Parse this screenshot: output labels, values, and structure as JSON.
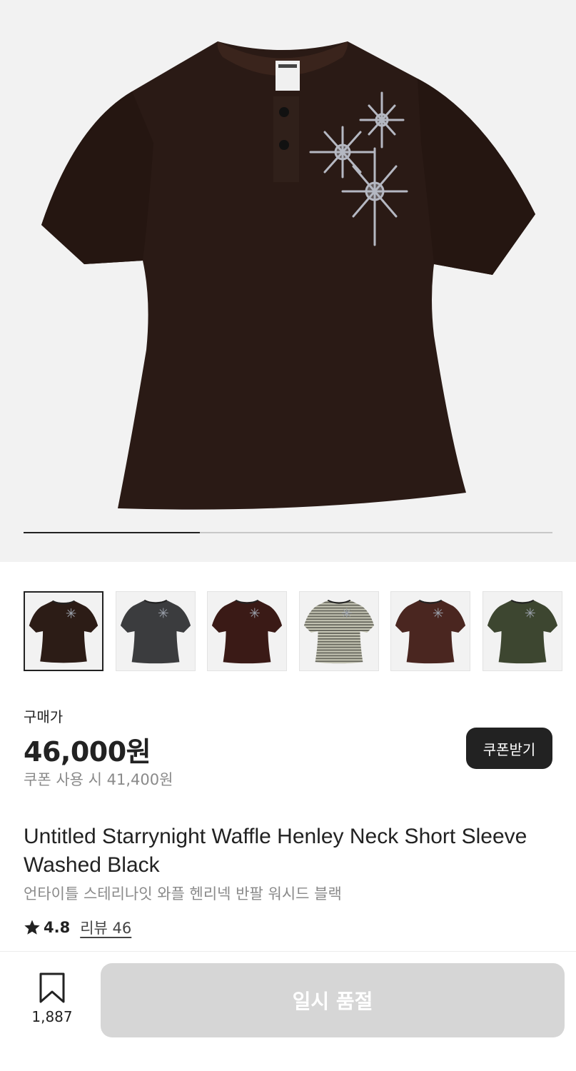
{
  "gallery": {
    "product_image": "henley-tee-washed-black",
    "progress_fraction": 0.333,
    "thumbnails": [
      {
        "color": "#2c1c16",
        "selected": true
      },
      {
        "color": "#3b3c3e",
        "selected": false
      },
      {
        "color": "#3a1a16",
        "selected": false
      },
      {
        "color": "#c9c9b8",
        "selected": false
      },
      {
        "color": "#4a2620",
        "selected": false
      },
      {
        "color": "#3d4630",
        "selected": false
      }
    ]
  },
  "pricing": {
    "label": "구매가",
    "price": "46,000원",
    "coupon_price": "쿠폰 사용 시 41,400원",
    "coupon_button": "쿠폰받기"
  },
  "product": {
    "title": "Untitled Starrynight Waffle Henley Neck Short Sleeve Washed Black",
    "subtitle": "언타이틀 스테리나잇 와플 헨리넥 반팔 워시드 블랙",
    "rating": "4.8",
    "reviews": "리뷰 46"
  },
  "bottom_bar": {
    "bookmark_count": "1,887",
    "soldout_label": "일시 품절"
  },
  "icons": {
    "star": "star-icon",
    "bookmark": "bookmark-icon"
  },
  "colors": {
    "shirt_main": "#2a1a15",
    "accent_dark": "#222222",
    "muted_text": "#8a8a8a",
    "disabled_button": "#d6d6d6"
  }
}
